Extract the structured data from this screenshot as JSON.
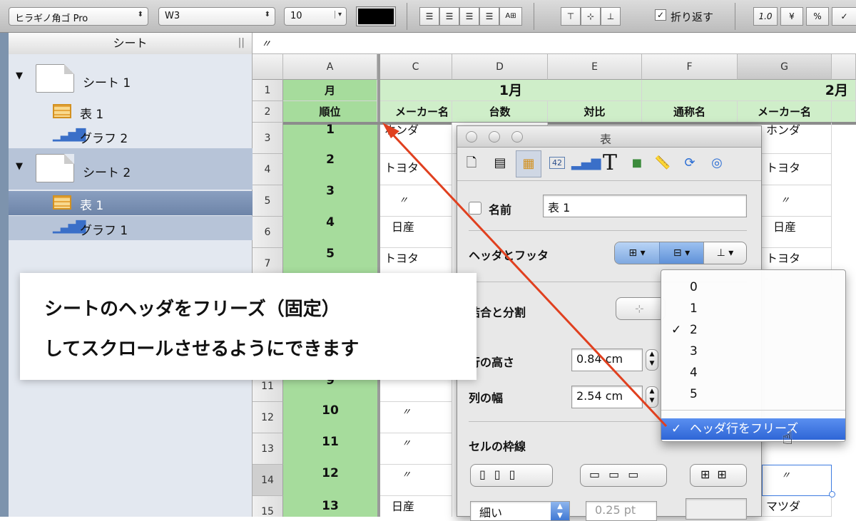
{
  "toolbar": {
    "font_family": "ヒラギノ角ゴ Pro",
    "font_weight": "W3",
    "font_size": "10",
    "align_buttons": [
      "left",
      "center",
      "right",
      "justify",
      "auto"
    ],
    "valign_buttons": [
      "top",
      "middle",
      "bottom"
    ],
    "wrap_label": "折り返す",
    "wrap_checked": true,
    "format_buttons": [
      "1.0",
      "¥",
      "%"
    ]
  },
  "sidebar": {
    "header": "シート",
    "items": [
      {
        "label": "シート 1",
        "type": "sheet"
      },
      {
        "label": "表 1",
        "type": "table"
      },
      {
        "label": "グラフ 2",
        "type": "chart"
      },
      {
        "label": "シート 2",
        "type": "sheet"
      },
      {
        "label": "表 1",
        "type": "table",
        "selected": true
      },
      {
        "label": "グラフ 1",
        "type": "chart"
      }
    ]
  },
  "formula_bar": {
    "value": "〃"
  },
  "grid": {
    "columns": [
      "A",
      "C",
      "D",
      "E",
      "F",
      "G"
    ],
    "rows": [
      "1",
      "2",
      "3",
      "4",
      "5",
      "6",
      "7",
      "11",
      "12",
      "13",
      "14",
      "15"
    ],
    "header_row1": {
      "month1": "1月",
      "month2": "2月",
      "col_a": "月"
    },
    "header_row2": [
      "順位",
      "メーカー名",
      "台数",
      "対比",
      "通称名",
      "メーカー名"
    ],
    "col_a_values": [
      "1",
      "2",
      "3",
      "4",
      "5",
      "9",
      "10",
      "11",
      "12",
      "13"
    ],
    "col_c_values": [
      "ホンダ",
      "トヨタ",
      "〃",
      "日産",
      "トヨタ",
      "〃",
      "〃",
      "〃",
      "〃",
      "日産"
    ],
    "col_g_values": [
      "ホンダ",
      "トヨタ",
      "〃",
      "日産",
      "トヨタ",
      "〃",
      "マツダ"
    ]
  },
  "inspector": {
    "title": "表",
    "tabs": [
      "document",
      "sheet",
      "table",
      "cell-format",
      "chart",
      "text",
      "shape",
      "metrics",
      "link",
      "quicktime"
    ],
    "name_label": "名前",
    "name_value": "表 1",
    "header_footer_label": "ヘッダとフッタ",
    "merge_split_label": "結合と分割",
    "row_height_label": "行の高さ",
    "row_height_value": "0.84 cm",
    "col_width_label": "列の幅",
    "col_width_value": "2.54 cm",
    "cell_border_label": "セルの枠線",
    "border_style_value": "細い",
    "border_width_value": "0.25 pt"
  },
  "dropdown": {
    "items": [
      "0",
      "1",
      "2",
      "3",
      "4",
      "5"
    ],
    "checked_index": 2,
    "freeze_label": "ヘッダ行をフリーズ",
    "freeze_checked": true
  },
  "callout": {
    "line1": "シートのヘッダをフリーズ（固定）",
    "line2": "してスクロールさせるようにできます"
  },
  "colors": {
    "header_green": "#cfeec9",
    "col_a_green": "#a6dc9c",
    "selection_blue": "#3d7be0",
    "arrow_red": "#e0401f"
  }
}
